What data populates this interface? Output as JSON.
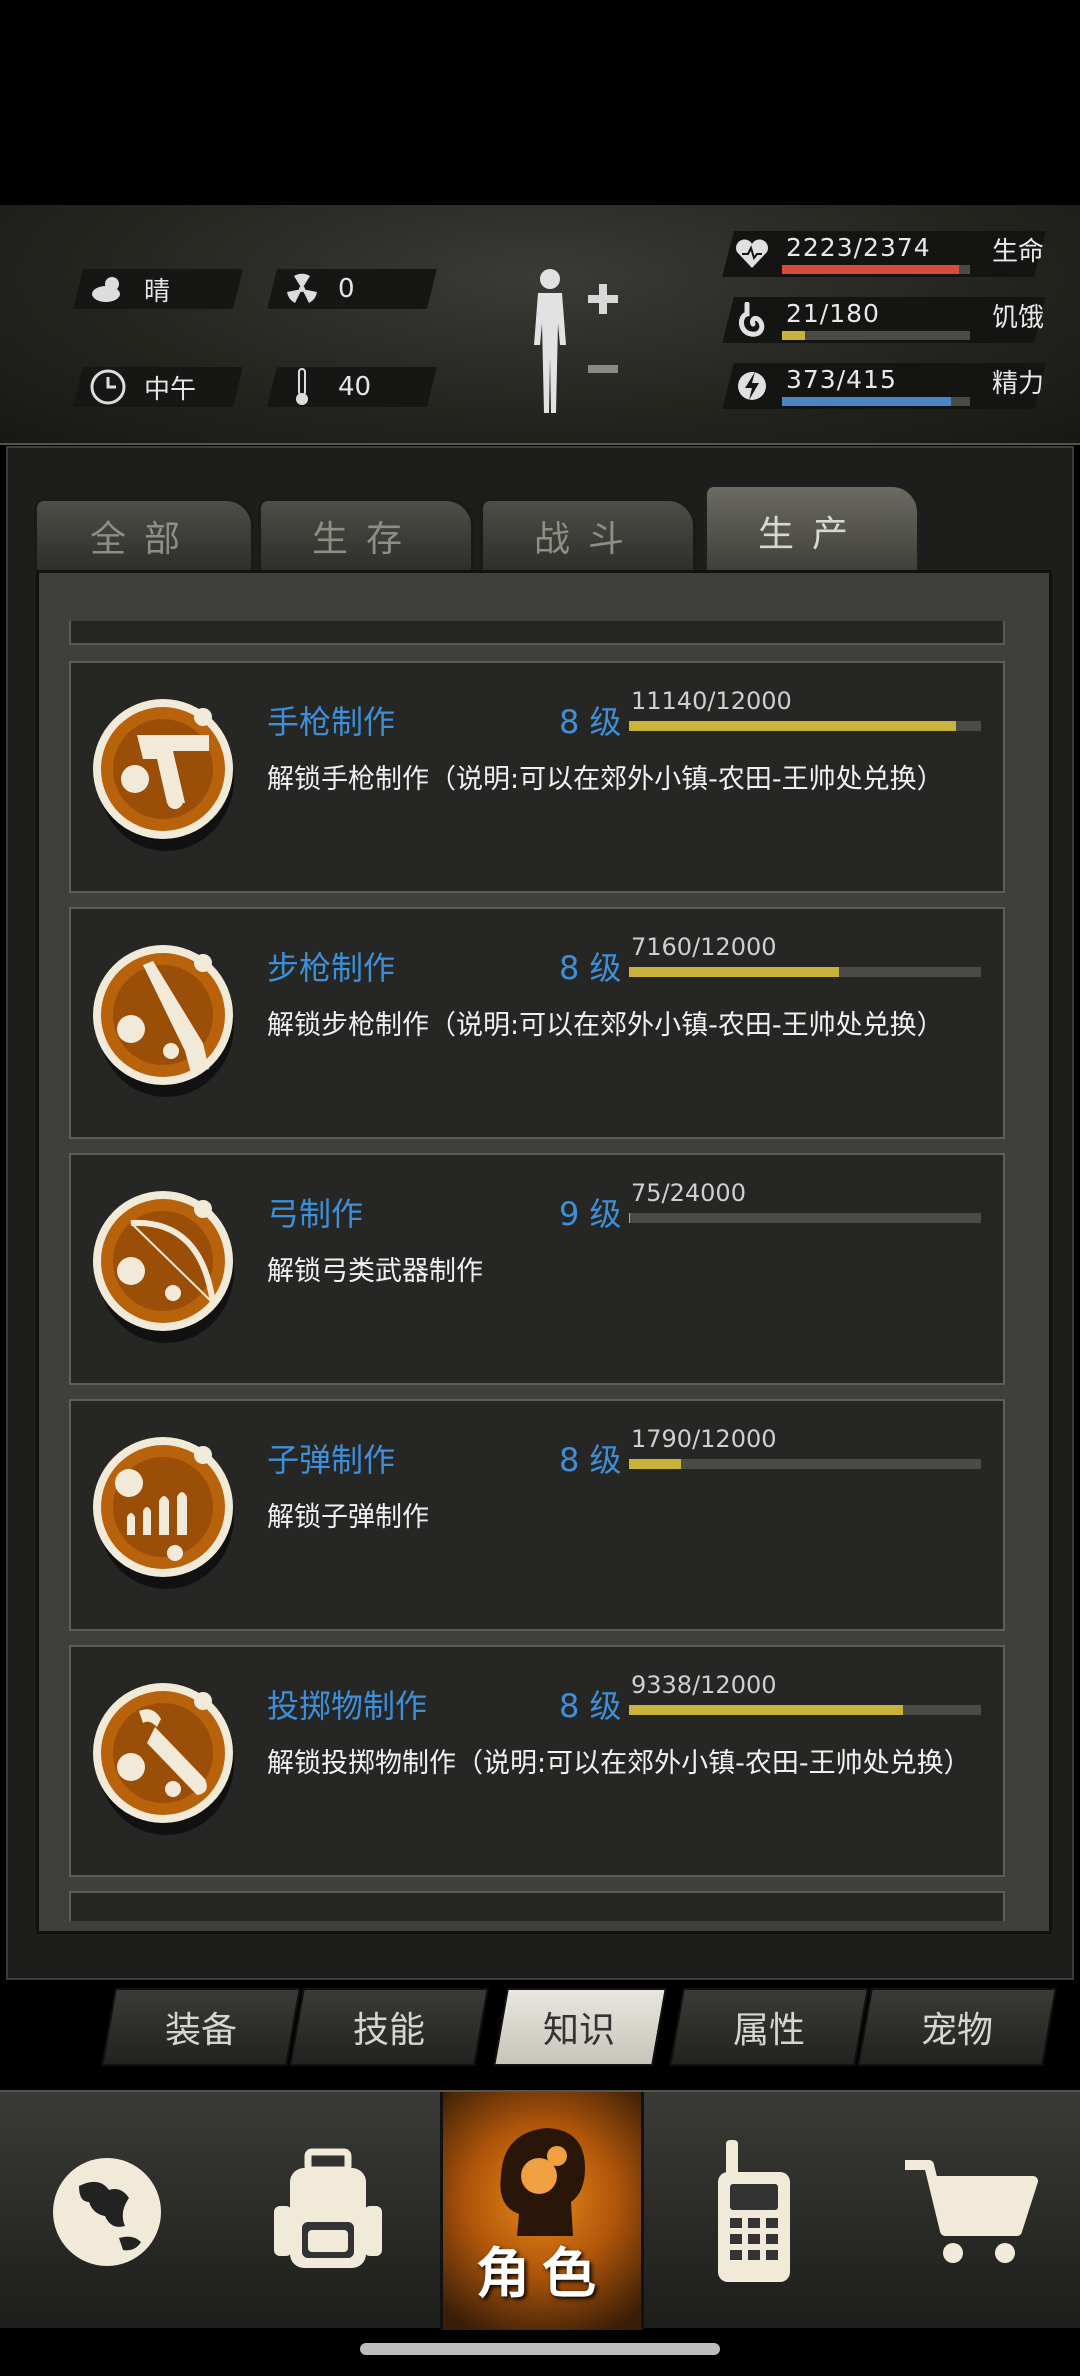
{
  "status": {
    "weather": "晴",
    "radiation": "0",
    "time_of_day": "中午",
    "temperature": "40",
    "health": {
      "value": "2223/2374",
      "label": "生命",
      "fill": 0.94,
      "color": "#d94b3a"
    },
    "hunger": {
      "value": "21/180",
      "label": "饥饿",
      "fill": 0.12,
      "color": "#c9b33a"
    },
    "energy": {
      "value": "373/415",
      "label": "精力",
      "fill": 0.9,
      "color": "#4a86c4"
    }
  },
  "tabs": [
    {
      "label": "全部",
      "active": false
    },
    {
      "label": "生存",
      "active": false
    },
    {
      "label": "战斗",
      "active": false
    },
    {
      "label": "生产",
      "active": true
    }
  ],
  "items": [
    {
      "name": "手枪制作",
      "level": "8 级",
      "progress": "11140/12000",
      "fill": 0.928,
      "desc": "解锁手枪制作（说明:可以在郊外小镇-农田-王帅处兑换）",
      "icon": "pistol-icon"
    },
    {
      "name": "步枪制作",
      "level": "8 级",
      "progress": "7160/12000",
      "fill": 0.597,
      "desc": "解锁步枪制作（说明:可以在郊外小镇-农田-王帅处兑换）",
      "icon": "rifle-icon"
    },
    {
      "name": "弓制作",
      "level": "9 级",
      "progress": "75/24000",
      "fill": 0.003,
      "desc": "解锁弓类武器制作",
      "icon": "bow-icon"
    },
    {
      "name": "子弹制作",
      "level": "8 级",
      "progress": "1790/12000",
      "fill": 0.149,
      "desc": "解锁子弹制作",
      "icon": "bullets-icon"
    },
    {
      "name": "投掷物制作",
      "level": "8 级",
      "progress": "9338/12000",
      "fill": 0.778,
      "desc": "解锁投掷物制作（说明:可以在郊外小镇-农田-王帅处兑换）",
      "icon": "grenade-icon"
    }
  ],
  "subtabs": [
    {
      "label": "装备",
      "active": false
    },
    {
      "label": "技能",
      "active": false
    },
    {
      "label": "知识",
      "active": true
    },
    {
      "label": "属性",
      "active": false
    },
    {
      "label": "宠物",
      "active": false
    }
  ],
  "bottom_nav": {
    "active_label": "角色",
    "icons": [
      "globe-icon",
      "backpack-icon",
      "character-icon",
      "radio-icon",
      "cart-icon"
    ]
  }
}
